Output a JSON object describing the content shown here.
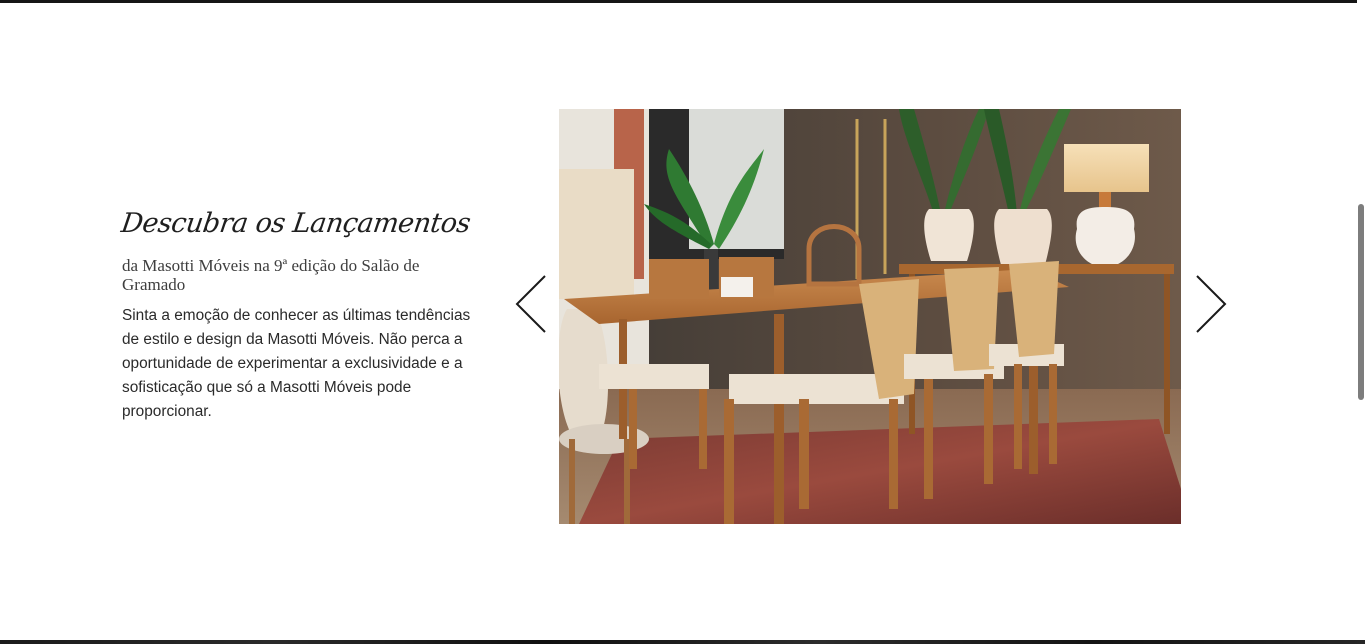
{
  "section": {
    "script_title": "Descubra os Lançamentos",
    "subtitle": "da Masotti Móveis na 9ª edição do Salão de Gramado",
    "body": "Sinta a emoção de conhecer as últimas tendências de estilo e design da Masotti Móveis. Não perca a oportunidade de experimentar a exclusividade e a sofisticação que só a Masotti Móveis pode proporcionar."
  },
  "carousel": {
    "prev_icon": "chevron-left-icon",
    "next_icon": "chevron-right-icon",
    "slide_subject": "dining-room-furniture-photo"
  },
  "colors": {
    "text_dark": "#1f1f1f",
    "wood": "#b5733e",
    "wall": "#5a4b3f",
    "rug": "#8c3b35"
  }
}
